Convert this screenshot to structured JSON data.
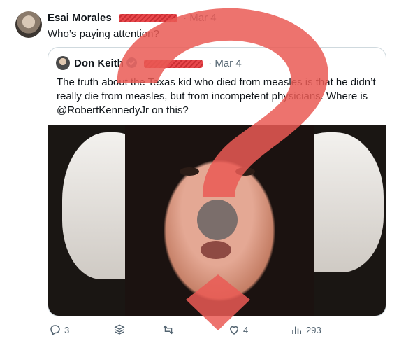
{
  "tweet": {
    "author_name": "Esai Morales",
    "separator": "·",
    "date": "Mar 4",
    "text": "Who’s paying attention?"
  },
  "quoted_tweet": {
    "author_name": "Don Keith",
    "separator": "·",
    "date": "Mar 4",
    "text": "The truth about the Texas kid who died from measles is that he didn’t really die from measles, but from incompetent physicians. Where is @RobertKennedyJr on this?"
  },
  "actions": {
    "replies": "3",
    "likes": "4",
    "views": "293"
  },
  "icons": [
    "reply-icon",
    "grok-icon",
    "retweet-icon",
    "like-icon",
    "views-icon",
    "verified-icon",
    "play-icon"
  ],
  "colors": {
    "overlay_red": "#ea5b55",
    "muted_text": "#536471",
    "border": "#cfd9de"
  }
}
